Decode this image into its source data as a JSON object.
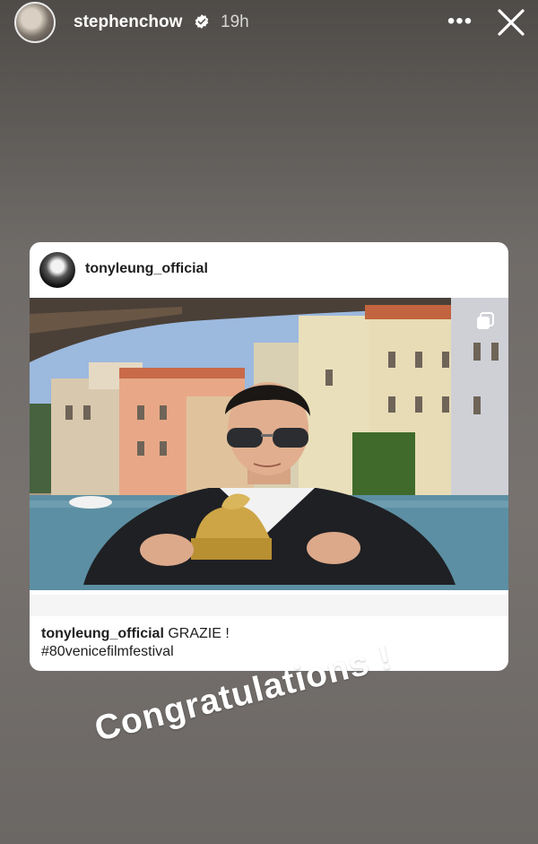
{
  "story": {
    "username": "stephenchow",
    "time": "19h",
    "more_label": "•••"
  },
  "post": {
    "username": "tonyleung_official",
    "caption_user": "tonyleung_official",
    "caption_text": " GRAZIE !",
    "hashtag": "#80venicefilmfestival"
  },
  "sticker": {
    "text": "Congratulations !"
  },
  "colors": {
    "background": "#6f6b68",
    "card": "#ffffff",
    "verified_badge": "#ffffff"
  },
  "icons": [
    "verified-icon",
    "more-icon",
    "close-icon",
    "multi-image-icon"
  ]
}
